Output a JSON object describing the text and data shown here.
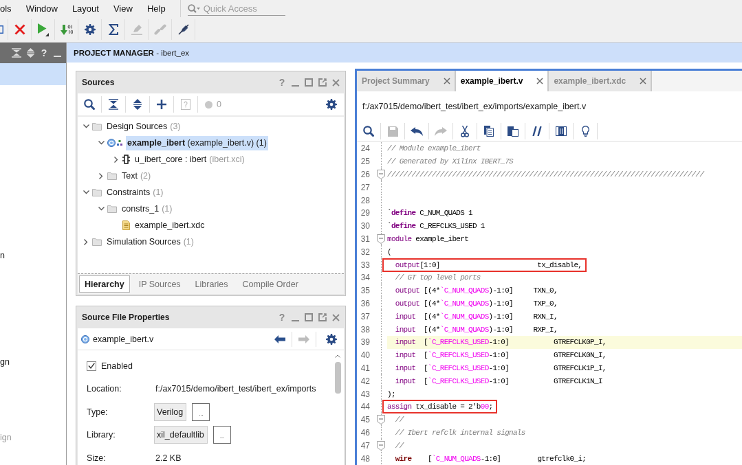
{
  "menu_bar": {
    "items": [
      "ols",
      "Window",
      "Layout",
      "View",
      "Help"
    ],
    "quick_access": {
      "placeholder": "Quick Access"
    }
  },
  "toolbar": [
    {
      "kind": "partial",
      "disabled": false
    },
    {
      "kind": "cancel",
      "disabled": false
    },
    {
      "kind": "run",
      "disabled": false
    },
    {
      "kind": "bitstream",
      "disabled": false
    },
    {
      "kind": "settings",
      "disabled": false
    },
    {
      "kind": "sigma",
      "disabled": false
    },
    {
      "kind": "probe",
      "disabled": true
    },
    {
      "kind": "link",
      "disabled": true
    },
    {
      "kind": "no-probe",
      "disabled": false
    }
  ],
  "flow_navigator": {
    "help": "?",
    "items": [
      {
        "kind": "section",
        "selected": true,
        "disabled": false
      },
      {
        "kind": "task",
        "label": "n",
        "selected": false,
        "disabled": false
      },
      {
        "kind": "task",
        "label": "gn",
        "selected": false,
        "disabled": false
      },
      {
        "kind": "task",
        "label": "ign",
        "selected": false,
        "disabled": true
      }
    ]
  },
  "project_manager": {
    "title": "**PROJECT MANAGER** - ibert_ex"
  },
  "sources": {
    "title": "Sources",
    "help": "?",
    "tools": [
      {
        "kind": "search",
        "disabled": false
      },
      {
        "kind": "collapse-all",
        "disabled": false
      },
      {
        "kind": "expand-all",
        "disabled": false
      },
      {
        "kind": "add",
        "disabled": false
      },
      {
        "kind": "help-doc",
        "disabled": true
      }
    ],
    "issues": {
      "count": "0"
    },
    "tree": [
      {
        "kind": "folder",
        "label": "Design Sources",
        "note": "(3)",
        "expanded": true,
        "selected": false,
        "children": [
          {
            "kind": "module",
            "label": "**example_ibert** (example_ibert.v) (1)",
            "expanded": true,
            "selected": true,
            "children": [
              {
                "kind": "ip",
                "label": "u_ibert_core : ibert",
                "note": "(ibert.xci)",
                "expanded": false,
                "selected": false
              }
            ]
          },
          {
            "kind": "folder",
            "label": "Text",
            "note": "(2)",
            "expanded": false,
            "selected": false
          }
        ]
      },
      {
        "kind": "folder",
        "label": "Constraints",
        "note": "(1)",
        "expanded": true,
        "selected": false,
        "children": [
          {
            "kind": "folder",
            "label": "constrs_1",
            "note": "(1)",
            "expanded": true,
            "selected": false,
            "children": [
              {
                "kind": "constraints-file",
                "label": "example_ibert.xdc",
                "selected": false
              }
            ]
          }
        ]
      },
      {
        "kind": "folder",
        "label": "Simulation Sources",
        "note": "(1)",
        "expanded": false,
        "selected": false
      }
    ],
    "tabs": [
      {
        "label": "Hierarchy",
        "selected": true
      },
      {
        "label": "IP Sources",
        "selected": false
      },
      {
        "label": "Libraries",
        "selected": false
      },
      {
        "label": "Compile Order",
        "selected": false
      }
    ]
  },
  "source_file_properties": {
    "title": "Source File Properties",
    "help": "?",
    "file": {
      "kind": "verilog",
      "name": "example_ibert.v"
    },
    "nav": [
      {
        "kind": "back",
        "disabled": false
      },
      {
        "kind": "forward",
        "disabled": true
      }
    ],
    "enabled": {
      "label": "Enabled",
      "checked": true
    },
    "fields": [
      {
        "kind": "text",
        "label": "Location:",
        "value": "f:/ax7015/demo/ibert_test/ibert_ex/imports"
      },
      {
        "kind": "choice",
        "label": "Type:",
        "value": "Verilog",
        "button": "..."
      },
      {
        "kind": "choice",
        "label": "Library:",
        "value": "xil_defaultlib",
        "button": "..."
      },
      {
        "kind": "text",
        "label": "Size:",
        "value": "2.2 KB"
      }
    ]
  },
  "editor": {
    "tabs": [
      {
        "label": "Project Summary",
        "selected": false
      },
      {
        "label": "example_ibert.v",
        "selected": true
      },
      {
        "label": "example_ibert.xdc",
        "selected": false
      }
    ],
    "path": "f:/ax7015/demo/ibert_test/ibert_ex/imports/example_ibert.v",
    "tools": [
      {
        "kind": "search",
        "disabled": false
      },
      {
        "kind": "save",
        "disabled": true
      },
      {
        "kind": "undo",
        "disabled": false
      },
      {
        "kind": "redo",
        "disabled": true
      },
      {
        "kind": "cut",
        "disabled": false
      },
      {
        "kind": "copy",
        "disabled": false
      },
      {
        "kind": "paste",
        "disabled": false
      },
      {
        "kind": "comment",
        "disabled": false
      },
      {
        "kind": "columns",
        "disabled": false
      },
      {
        "kind": "hint",
        "disabled": false
      }
    ],
    "lines": [
      {
        "number": "24",
        "fold": false,
        "current": false,
        "marked": false,
        "tokens": [
          {
            "kind": "comment",
            "text": "// Module example_ibert"
          }
        ]
      },
      {
        "number": "25",
        "fold": false,
        "current": false,
        "marked": false,
        "tokens": [
          {
            "kind": "comment",
            "text": "// Generated by Xilinx IBERT_7S"
          }
        ]
      },
      {
        "number": "26",
        "fold": true,
        "current": false,
        "marked": false,
        "tokens": [
          {
            "kind": "comment",
            "text": "//////////////////////////////////////////////////////////////////////////////"
          }
        ]
      },
      {
        "number": "27",
        "fold": false,
        "current": false,
        "marked": false
      },
      {
        "number": "28",
        "fold": false,
        "current": false,
        "marked": false
      },
      {
        "number": "29",
        "fold": false,
        "current": false,
        "marked": false,
        "tokens": [
          {
            "kind": "plain",
            "text": "`"
          },
          {
            "kind": "directive",
            "text": "define"
          },
          {
            "kind": "plain",
            "text": " C_NUM_QUADS 1"
          }
        ]
      },
      {
        "number": "30",
        "fold": false,
        "current": false,
        "marked": false,
        "tokens": [
          {
            "kind": "plain",
            "text": "`"
          },
          {
            "kind": "directive",
            "text": "define"
          },
          {
            "kind": "plain",
            "text": " C_REFCLKS_USED 1"
          }
        ]
      },
      {
        "number": "31",
        "fold": true,
        "current": false,
        "marked": false,
        "tokens": [
          {
            "kind": "keyword",
            "text": "module"
          },
          {
            "kind": "plain",
            "text": " example_ibert"
          }
        ]
      },
      {
        "number": "32",
        "fold": false,
        "current": false,
        "marked": false,
        "tokens": [
          {
            "kind": "plain",
            "text": "("
          }
        ]
      },
      {
        "number": "33",
        "fold": false,
        "current": false,
        "marked": true,
        "tokens": [
          {
            "kind": "keyword",
            "text": "  output"
          },
          {
            "kind": "plain",
            "text": "[1:0]                        tx_disable,"
          }
        ]
      },
      {
        "number": "34",
        "fold": false,
        "current": false,
        "marked": false,
        "tokens": [
          {
            "kind": "comment",
            "text": "  // GT top level ports"
          }
        ]
      },
      {
        "number": "35",
        "fold": false,
        "current": false,
        "marked": false,
        "tokens": [
          {
            "kind": "keyword",
            "text": "  output"
          },
          {
            "kind": "plain",
            "text": " [(4*"
          },
          {
            "kind": "macro",
            "text": "`C_NUM_QUADS"
          },
          {
            "kind": "plain",
            "text": ")-1:0]     TXN_0,"
          }
        ]
      },
      {
        "number": "36",
        "fold": false,
        "current": false,
        "marked": false,
        "tokens": [
          {
            "kind": "keyword",
            "text": "  output"
          },
          {
            "kind": "plain",
            "text": " [(4*"
          },
          {
            "kind": "macro",
            "text": "`C_NUM_QUADS"
          },
          {
            "kind": "plain",
            "text": ")-1:0]     TXP_0,"
          }
        ]
      },
      {
        "number": "37",
        "fold": false,
        "current": false,
        "marked": false,
        "tokens": [
          {
            "kind": "keyword",
            "text": "  input"
          },
          {
            "kind": "plain",
            "text": "  [(4*"
          },
          {
            "kind": "macro",
            "text": "`C_NUM_QUADS"
          },
          {
            "kind": "plain",
            "text": ")-1:0]     RXN_I,"
          }
        ]
      },
      {
        "number": "38",
        "fold": false,
        "current": false,
        "marked": false,
        "tokens": [
          {
            "kind": "keyword",
            "text": "  input"
          },
          {
            "kind": "plain",
            "text": "  [(4*"
          },
          {
            "kind": "macro",
            "text": "`C_NUM_QUADS"
          },
          {
            "kind": "plain",
            "text": ")-1:0]     RXP_I,"
          }
        ]
      },
      {
        "number": "39",
        "fold": false,
        "current": true,
        "marked": false,
        "tokens": [
          {
            "kind": "keyword",
            "text": "  input"
          },
          {
            "kind": "plain",
            "text": "  ["
          },
          {
            "kind": "macro",
            "text": "`C_REFCLKS_USED"
          },
          {
            "kind": "plain",
            "text": "-1:0]           GTREFCLK0P_I,"
          }
        ]
      },
      {
        "number": "40",
        "fold": false,
        "current": false,
        "marked": false,
        "tokens": [
          {
            "kind": "keyword",
            "text": "  input"
          },
          {
            "kind": "plain",
            "text": "  ["
          },
          {
            "kind": "macro",
            "text": "`C_REFCLKS_USED"
          },
          {
            "kind": "plain",
            "text": "-1:0]           GTREFCLK0N_I,"
          }
        ]
      },
      {
        "number": "41",
        "fold": false,
        "current": false,
        "marked": false,
        "tokens": [
          {
            "kind": "keyword",
            "text": "  input"
          },
          {
            "kind": "plain",
            "text": "  ["
          },
          {
            "kind": "macro",
            "text": "`C_REFCLKS_USED"
          },
          {
            "kind": "plain",
            "text": "-1:0]           GTREFCLK1P_I,"
          }
        ]
      },
      {
        "number": "42",
        "fold": false,
        "current": false,
        "marked": false,
        "tokens": [
          {
            "kind": "keyword",
            "text": "  input"
          },
          {
            "kind": "plain",
            "text": "  ["
          },
          {
            "kind": "macro",
            "text": "`C_REFCLKS_USED"
          },
          {
            "kind": "plain",
            "text": "-1:0]           GTREFCLK1N_I"
          }
        ]
      },
      {
        "number": "43",
        "fold": false,
        "current": false,
        "marked": false,
        "tokens": [
          {
            "kind": "plain",
            "text": ");"
          }
        ]
      },
      {
        "number": "44",
        "fold": false,
        "current": false,
        "marked": true,
        "tokens": [
          {
            "kind": "keyword",
            "text": "assign"
          },
          {
            "kind": "plain",
            "text": " tx_disable = 2'b"
          },
          {
            "kind": "number",
            "text": "00"
          },
          {
            "kind": "plain",
            "text": ";"
          }
        ]
      },
      {
        "number": "45",
        "fold": true,
        "current": false,
        "marked": false,
        "tokens": [
          {
            "kind": "comment",
            "text": "  //"
          }
        ]
      },
      {
        "number": "46",
        "fold": false,
        "current": false,
        "marked": false,
        "tokens": [
          {
            "kind": "comment",
            "text": "  // Ibert refclk internal signals"
          }
        ]
      },
      {
        "number": "47",
        "fold": true,
        "current": false,
        "marked": false,
        "tokens": [
          {
            "kind": "comment",
            "text": "  //"
          }
        ]
      },
      {
        "number": "48",
        "fold": false,
        "current": false,
        "marked": false,
        "tokens": [
          {
            "kind": "type",
            "text": "  wire"
          },
          {
            "kind": "plain",
            "text": "    ["
          },
          {
            "kind": "macro",
            "text": "`C_NUM_QUADS"
          },
          {
            "kind": "plain",
            "text": "-1:0]         gtrefclk0_i;"
          }
        ]
      }
    ]
  }
}
